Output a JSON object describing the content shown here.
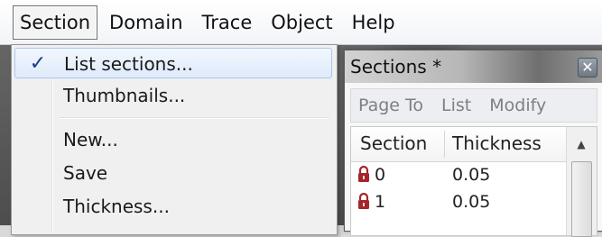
{
  "menubar": {
    "items": [
      "Section",
      "Domain",
      "Trace",
      "Object",
      "Help"
    ]
  },
  "dropdown": {
    "checked_mark": "✓",
    "items": [
      "List sections...",
      "Thumbnails...",
      "New...",
      "Save",
      "Thickness..."
    ]
  },
  "sections_window": {
    "title": "Sections *",
    "close_glyph": "✕",
    "menu": [
      "Page To",
      "List",
      "Modify"
    ],
    "columns": [
      "Section",
      "Thickness"
    ],
    "rows": [
      {
        "section": "0",
        "thickness": "0.05"
      },
      {
        "section": "1",
        "thickness": "0.05"
      }
    ]
  },
  "colors": {
    "lock_icon": "#a5262a",
    "highlight_border": "#a9c7ef",
    "check": "#1b3b82"
  }
}
